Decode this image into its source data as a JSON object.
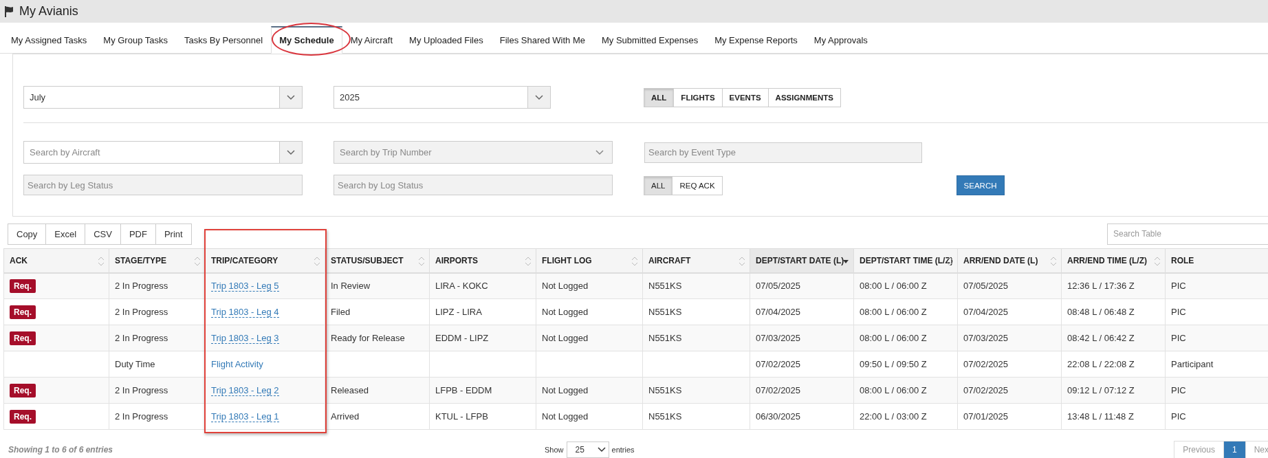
{
  "header": {
    "title": "My Avianis"
  },
  "tabs": [
    {
      "label": "My Assigned Tasks",
      "selected": false
    },
    {
      "label": "My Group Tasks",
      "selected": false
    },
    {
      "label": "Tasks By Personnel",
      "selected": false
    },
    {
      "label": "My Schedule",
      "selected": true
    },
    {
      "label": "My Aircraft",
      "selected": false
    },
    {
      "label": "My Uploaded Files",
      "selected": false
    },
    {
      "label": "Files Shared With Me",
      "selected": false
    },
    {
      "label": "My Submitted Expenses",
      "selected": false
    },
    {
      "label": "My Expense Reports",
      "selected": false
    },
    {
      "label": "My Approvals",
      "selected": false
    }
  ],
  "filters": {
    "month": {
      "value": "July"
    },
    "year": {
      "value": "2025"
    },
    "type_buttons": [
      {
        "label": "ALL",
        "selected": true
      },
      {
        "label": "FLIGHTS",
        "selected": false
      },
      {
        "label": "EVENTS",
        "selected": false
      },
      {
        "label": "ASSIGNMENTS",
        "selected": false
      }
    ],
    "aircraft": {
      "placeholder": "Search by Aircraft"
    },
    "trip_number": {
      "placeholder": "Search by Trip Number"
    },
    "event_type": {
      "placeholder": "Search by Event Type"
    },
    "leg_status": {
      "placeholder": "Search by Leg Status"
    },
    "log_status": {
      "placeholder": "Search by Log Status"
    },
    "ack_buttons": [
      {
        "label": "ALL",
        "selected": true
      },
      {
        "label": "REQ ACK",
        "selected": false
      }
    ],
    "search_button": "SEARCH"
  },
  "export_buttons": [
    "Copy",
    "Excel",
    "CSV",
    "PDF",
    "Print"
  ],
  "table_search": {
    "placeholder": "Search Table"
  },
  "table": {
    "columns": [
      {
        "label": "ACK",
        "sorted": false
      },
      {
        "label": "STAGE/TYPE",
        "sorted": false
      },
      {
        "label": "TRIP/CATEGORY",
        "sorted": false
      },
      {
        "label": "STATUS/SUBJECT",
        "sorted": false
      },
      {
        "label": "AIRPORTS",
        "sorted": false
      },
      {
        "label": "FLIGHT LOG",
        "sorted": false
      },
      {
        "label": "AIRCRAFT",
        "sorted": false
      },
      {
        "label": "DEPT/START DATE (L)",
        "sorted": true
      },
      {
        "label": "DEPT/START TIME (L/Z)",
        "sorted": false
      },
      {
        "label": "ARR/END DATE (L)",
        "sorted": false
      },
      {
        "label": "ARR/END TIME (L/Z)",
        "sorted": false
      },
      {
        "label": "ROLE"
      }
    ],
    "rows": [
      {
        "ack": "Req.",
        "stage": "2 In Progress",
        "trip": {
          "label": "Trip 1803 - Leg 5",
          "dashed": true
        },
        "status": "In Review",
        "airports": "LIRA - KOKC",
        "flight_log": "Not Logged",
        "aircraft": "N551KS",
        "dept_date": "07/05/2025",
        "dept_time": "08:00 L / 06:00 Z",
        "arr_date": "07/05/2025",
        "arr_time": "12:36 L / 17:36 Z",
        "role": "PIC"
      },
      {
        "ack": "Req.",
        "stage": "2 In Progress",
        "trip": {
          "label": "Trip 1803 - Leg 4",
          "dashed": true
        },
        "status": "Filed",
        "airports": "LIPZ - LIRA",
        "flight_log": "Not Logged",
        "aircraft": "N551KS",
        "dept_date": "07/04/2025",
        "dept_time": "08:00 L / 06:00 Z",
        "arr_date": "07/04/2025",
        "arr_time": "08:48 L / 06:48 Z",
        "role": "PIC"
      },
      {
        "ack": "Req.",
        "stage": "2 In Progress",
        "trip": {
          "label": "Trip 1803 - Leg 3",
          "dashed": true
        },
        "status": "Ready for Release",
        "airports": "EDDM - LIPZ",
        "flight_log": "Not Logged",
        "aircraft": "N551KS",
        "dept_date": "07/03/2025",
        "dept_time": "08:00 L / 06:00 Z",
        "arr_date": "07/03/2025",
        "arr_time": "08:42 L / 06:42 Z",
        "role": "PIC"
      },
      {
        "stage": "Duty Time",
        "trip": {
          "label": "Flight Activity",
          "dashed": false
        },
        "dept_date": "07/02/2025",
        "dept_time": "09:50 L / 09:50 Z",
        "arr_date": "07/02/2025",
        "arr_time": "22:08 L / 22:08 Z",
        "role": "Participant"
      },
      {
        "ack": "Req.",
        "stage": "2 In Progress",
        "trip": {
          "label": "Trip 1803 - Leg 2",
          "dashed": true
        },
        "status": "Released",
        "airports": "LFPB - EDDM",
        "flight_log": "Not Logged",
        "aircraft": "N551KS",
        "dept_date": "07/02/2025",
        "dept_time": "08:00 L / 06:00 Z",
        "arr_date": "07/02/2025",
        "arr_time": "09:12 L / 07:12 Z",
        "role": "PIC"
      },
      {
        "ack": "Req.",
        "stage": "2 In Progress",
        "trip": {
          "label": "Trip 1803 - Leg 1",
          "dashed": true
        },
        "status": "Arrived",
        "airports": "KTUL - LFPB",
        "flight_log": "Not Logged",
        "aircraft": "N551KS",
        "dept_date": "06/30/2025",
        "dept_time": "22:00 L / 03:00 Z",
        "arr_date": "07/01/2025",
        "arr_time": "13:48 L / 11:48 Z",
        "role": "PIC"
      }
    ]
  },
  "footer": {
    "info": "Showing 1 to 6 of 6 entries",
    "show_label": "Show",
    "page_size": "25",
    "entries_label": "entries",
    "pagination": [
      {
        "label": "Previous",
        "selected": false
      },
      {
        "label": "1",
        "selected": true
      },
      {
        "label": "Nex",
        "selected": false
      }
    ]
  }
}
